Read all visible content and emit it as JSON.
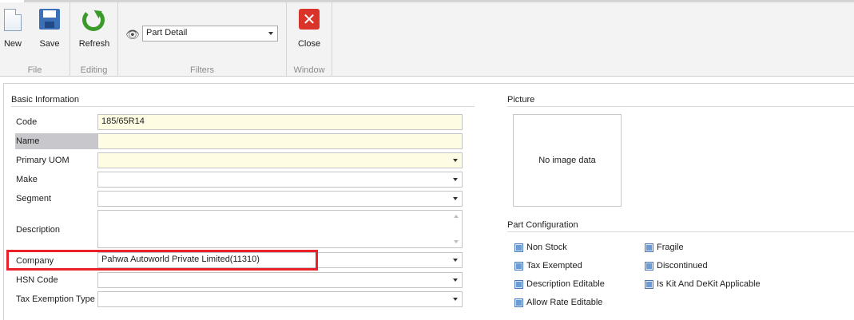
{
  "ribbon": {
    "groups": {
      "file": {
        "caption": "File",
        "new_label": "New",
        "save_label": "Save"
      },
      "editing": {
        "caption": "Editing",
        "refresh_label": "Refresh"
      },
      "filters": {
        "caption": "Filters",
        "selected": "Part Detail"
      },
      "window": {
        "caption": "Window",
        "close_label": "Close"
      }
    }
  },
  "basic_info": {
    "title": "Basic Information",
    "fields": {
      "code": {
        "label": "Code",
        "value": "185/65R14"
      },
      "name": {
        "label": "Name",
        "value": ""
      },
      "primary_uom": {
        "label": "Primary UOM",
        "value": ""
      },
      "make": {
        "label": "Make",
        "value": ""
      },
      "segment": {
        "label": "Segment",
        "value": ""
      },
      "description": {
        "label": "Description",
        "value": ""
      },
      "company": {
        "label": "Company",
        "value": "Pahwa Autoworld Private Limited(11310)"
      },
      "hsn_code": {
        "label": "HSN Code",
        "value": ""
      },
      "tax_exemption_type": {
        "label": "Tax Exemption Type",
        "value": ""
      }
    }
  },
  "picture": {
    "title": "Picture",
    "placeholder": "No image data"
  },
  "part_config": {
    "title": "Part Configuration",
    "options": {
      "non_stock": "Non Stock",
      "tax_exempted": "Tax Exempted",
      "description_editable": "Description Editable",
      "allow_rate_editable": "Allow Rate Editable",
      "fragile": "Fragile",
      "discontinued": "Discontinued",
      "kit_dekit": "Is Kit And DeKit Applicable"
    }
  },
  "colors": {
    "required_field": "#fefde3",
    "highlight": "#e8212a",
    "checkbox": "#6c9bd6"
  }
}
